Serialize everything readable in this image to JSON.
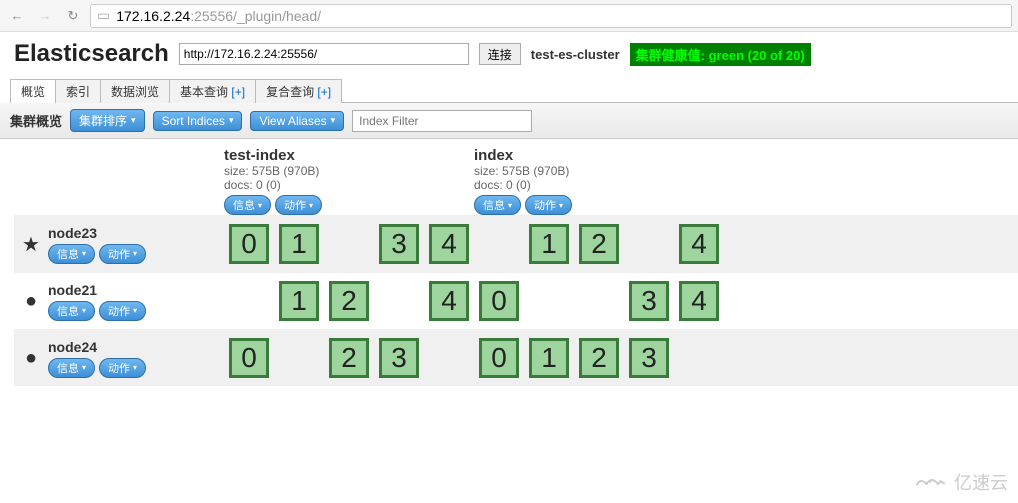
{
  "browser": {
    "url_ip": "172.16.2.24",
    "url_rest": ":25556/_plugin/head/"
  },
  "header": {
    "logo": "Elasticsearch",
    "cluster_url": "http://172.16.2.24:25556/",
    "connect": "连接",
    "cluster_name": "test-es-cluster",
    "health": "集群健康值: green (20 of 20)"
  },
  "tabs": [
    {
      "label": "概览",
      "active": true,
      "plus": false
    },
    {
      "label": "索引",
      "active": false,
      "plus": false
    },
    {
      "label": "数据浏览",
      "active": false,
      "plus": false
    },
    {
      "label": "基本查询",
      "active": false,
      "plus": true
    },
    {
      "label": "复合查询",
      "active": false,
      "plus": true
    }
  ],
  "toolbar": {
    "label": "集群概览",
    "sort_cluster": "集群排序",
    "sort_indices": "Sort Indices",
    "view_aliases": "View Aliases",
    "filter_placeholder": "Index Filter"
  },
  "pills": {
    "info": "信息",
    "action": "动作"
  },
  "indices": [
    {
      "name": "test-index",
      "size": "size: 575B (970B)",
      "docs": "docs: 0 (0)"
    },
    {
      "name": "index",
      "size": "size: 575B (970B)",
      "docs": "docs: 0 (0)"
    }
  ],
  "nodes": [
    {
      "name": "node23",
      "master": true,
      "shards": [
        [
          "0",
          "1",
          "",
          "3",
          "4"
        ],
        [
          "",
          "1",
          "2",
          "",
          "4"
        ]
      ]
    },
    {
      "name": "node21",
      "master": false,
      "shards": [
        [
          "",
          "1",
          "2",
          "",
          "4"
        ],
        [
          "0",
          "",
          "",
          "3",
          "4"
        ]
      ]
    },
    {
      "name": "node24",
      "master": false,
      "shards": [
        [
          "0",
          "",
          "2",
          "3",
          ""
        ],
        [
          "0",
          "1",
          "2",
          "3",
          ""
        ]
      ]
    }
  ],
  "watermark": "亿速云"
}
